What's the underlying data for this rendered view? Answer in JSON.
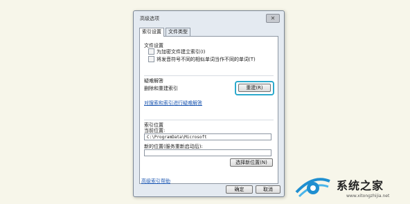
{
  "dialog": {
    "title": "高级选项",
    "close_glyph": "✕",
    "tabs": [
      "索引设置",
      "文件类型"
    ],
    "file_settings": {
      "label": "文件设置",
      "options": [
        "为加密文件建立索引(I)",
        "将发音符号不同的相似单词当作不同的单词(T)"
      ]
    },
    "troubleshoot": {
      "label": "疑难解答",
      "rebuild_text": "删除和重建索引",
      "rebuild_button": "重建(R)",
      "link": "对搜索和索引进行疑难解答"
    },
    "index_location": {
      "label": "索引位置",
      "current_label": "当前位置:",
      "current_value": "C:\\ProgramData\\Microsoft",
      "new_label": "新的位置(服务重新启动后):",
      "new_value": "",
      "select_button": "选择新位置(N)"
    },
    "help_link": "高级索引帮助",
    "ok_button": "确定",
    "cancel_button": "取消"
  },
  "watermark": {
    "text": "系统之家",
    "url": "www.xitongzhijia.net"
  },
  "colors": {
    "highlight": "#2ba9cc",
    "link": "#1a55b0"
  }
}
